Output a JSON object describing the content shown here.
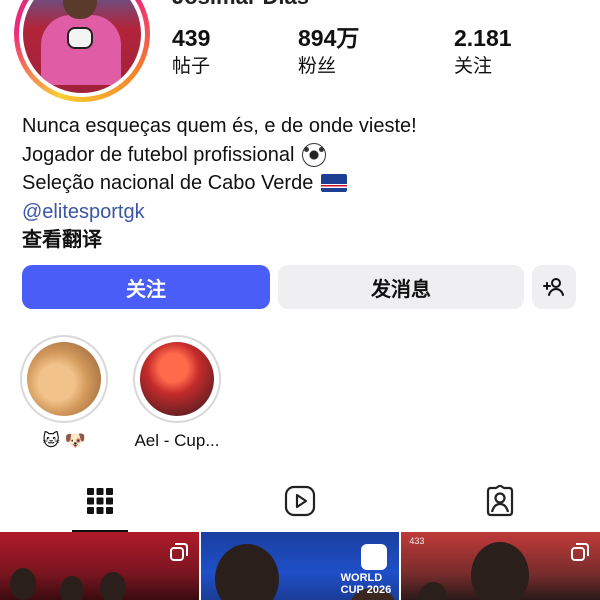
{
  "profile": {
    "name": "Josimar Dias"
  },
  "stats": [
    {
      "value": "439",
      "label": "帖子"
    },
    {
      "value": "894万",
      "label": "粉丝"
    },
    {
      "value": "2.181",
      "label": "关注"
    }
  ],
  "bio": {
    "line1": "Nunca esqueças quem és, e de onde vieste!",
    "line2": "Jogador de futebol profissional",
    "line3": "Seleção nacional de Cabo Verde",
    "link": "@elitesportgk",
    "translate": "查看翻译"
  },
  "buttons": {
    "follow": "关注",
    "message": "发消息"
  },
  "highlights": [
    {
      "label": "🐱 🐶"
    },
    {
      "label": "Ael - Cup..."
    }
  ],
  "grid": {
    "post2_text": "WORLD CUP 2026",
    "post3_text": "433"
  },
  "colors": {
    "follow_button": "#4a5ef7",
    "secondary_button": "#efeff1",
    "link": "#3b56a6"
  },
  "icons": {
    "tab_posts": "grid-icon",
    "tab_reels": "reels-icon",
    "tab_tagged": "tagged-icon",
    "add_person": "add-person-icon"
  }
}
